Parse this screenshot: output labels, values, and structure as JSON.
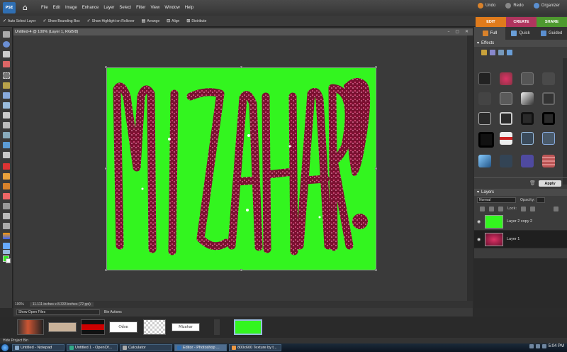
{
  "menubar": {
    "logo_text": "PSE",
    "items": [
      "File",
      "Edit",
      "Image",
      "Enhance",
      "Layer",
      "Select",
      "Filter",
      "View",
      "Window",
      "Help"
    ],
    "undo": "Undo",
    "redo": "Redo",
    "organizer": "Organizer"
  },
  "options": {
    "auto_select": "Auto Select Layer",
    "bounding_box": "Show Bounding Box",
    "highlight": "Show Highlight on Rollover",
    "arrange": "Arrange",
    "align": "Align",
    "distribute": "Distribute"
  },
  "mode_tabs": [
    "EDIT",
    "CREATE",
    "SHARE"
  ],
  "document": {
    "title": "Untitled-4 @ 100% (Layer 1, RGB/8)",
    "zoom": "100%",
    "size_info": "11.111 inches x 8.333 inches (72 ppi)",
    "canvas_color": "#33f51f",
    "artwork_text": "MIZAHAR!"
  },
  "panel": {
    "tabs": [
      "Full",
      "Quick",
      "Guided"
    ],
    "effects_title": "Effects",
    "apply": "Apply",
    "layers_title": "Layers",
    "blend_mode": "Normal",
    "opacity_label": "Opacity:",
    "lock_label": "Lock:",
    "layers": [
      {
        "name": "Layer 2 copy 2"
      },
      {
        "name": "Layer 1"
      }
    ]
  },
  "bin": {
    "select": "Show Open Files",
    "actions": "Bin Actions",
    "hide": "Hide Project Bin",
    "thumbs": [
      "Odon",
      "Mizahar"
    ]
  },
  "taskbar": {
    "tasks": [
      "Untitled - Notepad",
      "Untitled 1 - OpenOf...",
      "Calculator",
      "Editor - Photoshop ...",
      "800x600 Texture by t..."
    ],
    "clock": "5:04 PM"
  }
}
